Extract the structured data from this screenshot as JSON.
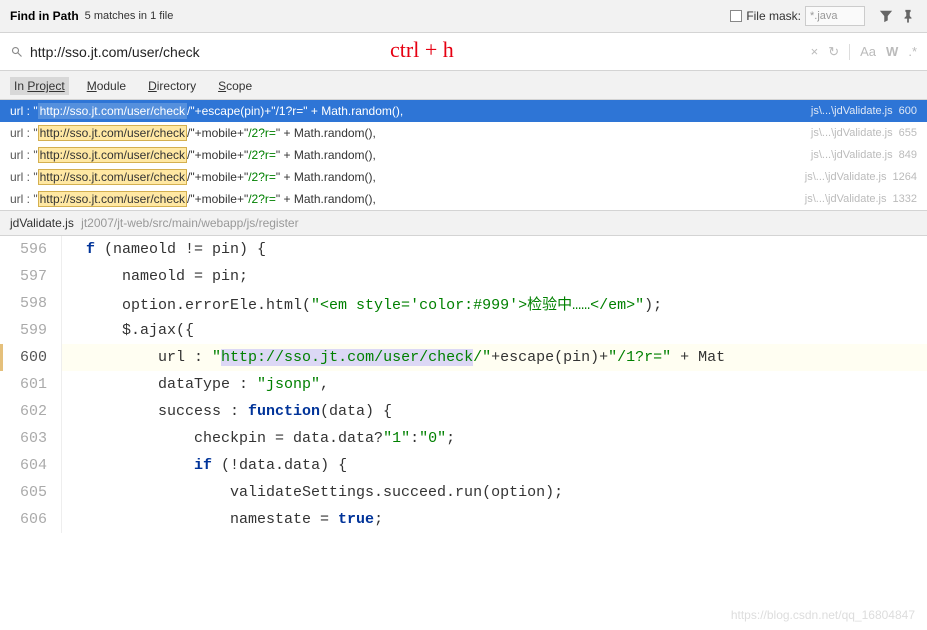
{
  "header": {
    "title": "Find in Path",
    "sub": "5 matches in 1 file",
    "filemask_label": "File mask:",
    "filemask_value": "*.java"
  },
  "search": {
    "value": "http://sso.jt.com/user/check",
    "annotation": "ctrl + h",
    "actions": {
      "aa": "Aa",
      "w": "W",
      "regex": ".*"
    }
  },
  "tabs": {
    "project": "Project",
    "module": "Module",
    "directory": "Directory",
    "scope": "Scope"
  },
  "results": [
    {
      "prefix": "url : \"",
      "hl": "http://sso.jt.com/user/check",
      "mid": "/\"+escape(pin)+\"",
      "grn": "/1?r=",
      "tail": "\" + Math.random(),",
      "path": "js\\...\\jdValidate.js",
      "lineno": "600",
      "selected": true
    },
    {
      "prefix": "url : \"",
      "hl": "http://sso.jt.com/user/check",
      "mid": "/\"+mobile+\"",
      "grn": "/2?r=",
      "tail": "\" + Math.random(),",
      "path": "js\\...\\jdValidate.js",
      "lineno": "655",
      "selected": false
    },
    {
      "prefix": "url : \"",
      "hl": "http://sso.jt.com/user/check",
      "mid": "/\"+mobile+\"",
      "grn": "/2?r=",
      "tail": "\" + Math.random(),",
      "path": "js\\...\\jdValidate.js",
      "lineno": "849",
      "selected": false
    },
    {
      "prefix": "url : \"",
      "hl": "http://sso.jt.com/user/check",
      "mid": "/\"+mobile+\"",
      "grn": "/2?r=",
      "tail": "\" + Math.random(),",
      "path": "js\\...\\jdValidate.js",
      "lineno": "1264",
      "selected": false
    },
    {
      "prefix": "url : \"",
      "hl": "http://sso.jt.com/user/check",
      "mid": "/\"+mobile+\"",
      "grn": "/2?r=",
      "tail": "\" + Math.random(),",
      "path": "js\\...\\jdValidate.js",
      "lineno": "1332",
      "selected": false
    }
  ],
  "preview": {
    "file": "jdValidate.js",
    "path": "jt2007/jt-web/src/main/webapp/js/register"
  },
  "code": {
    "l596": {
      "n": "596",
      "a": "f",
      "b": " (nameold != pin) {"
    },
    "l597": {
      "n": "597",
      "a": "    nameold = pin;"
    },
    "l598": {
      "n": "598",
      "a": "    option.errorEle.html(",
      "s": "\"<em style='color:#999'>检验中……</em>\"",
      "b": ");"
    },
    "l599": {
      "n": "599",
      "a": "    $.ajax({"
    },
    "l600": {
      "n": "600",
      "a": "        url : ",
      "q1": "\"",
      "hl": "http://sso.jt.com/user/check",
      "s2": "/\"",
      "b2": "+escape(pin)+",
      "s3": "\"/1?r=\"",
      "b3": " + Mat"
    },
    "l601": {
      "n": "601",
      "a": "        dataType : ",
      "s": "\"jsonp\"",
      "b": ","
    },
    "l602": {
      "n": "602",
      "a": "        success : ",
      "k": "function",
      "b": "(data) {"
    },
    "l603": {
      "n": "603",
      "a": "            checkpin = data.data?",
      "s1": "\"1\"",
      "c": ":",
      "s2": "\"0\"",
      "b": ";"
    },
    "l604": {
      "n": "604",
      "a": "            ",
      "k": "if",
      "b": " (!data.data) {"
    },
    "l605": {
      "n": "605",
      "a": "                validateSettings.succeed.run(option);"
    },
    "l606": {
      "n": "606",
      "a": "                namestate = ",
      "k": "true",
      "b": ";"
    }
  },
  "watermark": "https://blog.csdn.net/qq_16804847"
}
